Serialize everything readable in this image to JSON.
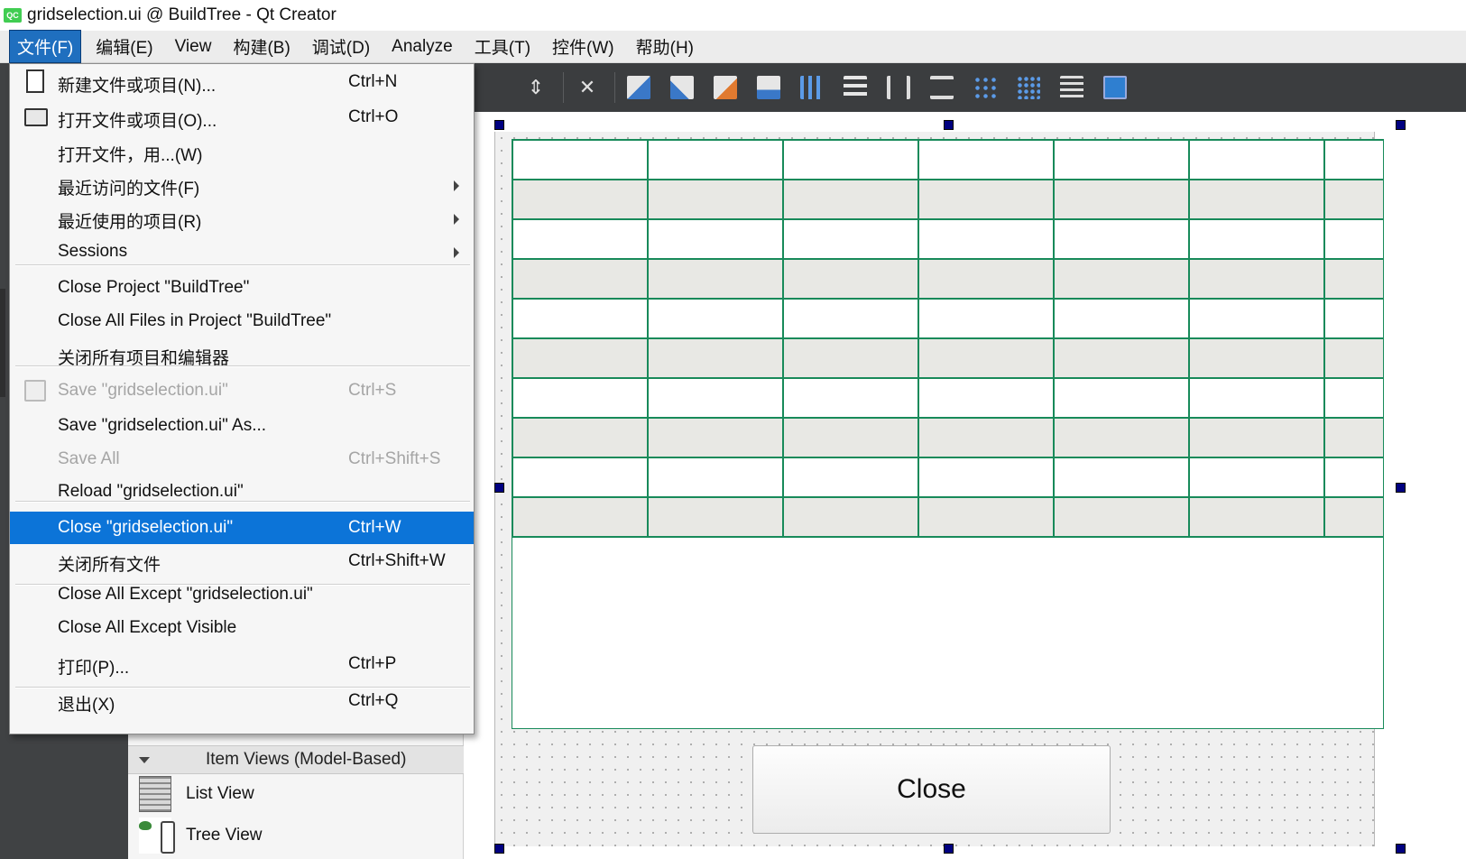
{
  "window": {
    "title": "gridselection.ui @ BuildTree - Qt Creator",
    "app_icon_text": "QC"
  },
  "menubar": {
    "items": [
      {
        "label": "文件(F)",
        "active": true
      },
      {
        "label": "编辑(E)"
      },
      {
        "label": "View"
      },
      {
        "label": "构建(B)"
      },
      {
        "label": "调试(D)"
      },
      {
        "label": "Analyze"
      },
      {
        "label": "工具(T)"
      },
      {
        "label": "控件(W)"
      },
      {
        "label": "帮助(H)"
      }
    ]
  },
  "file_menu": {
    "items": [
      {
        "label": "新建文件或项目(N)...",
        "shortcut": "Ctrl+N",
        "icon": "new-file-icon"
      },
      {
        "label": "打开文件或项目(O)...",
        "shortcut": "Ctrl+O",
        "icon": "open-folder-icon"
      },
      {
        "label": "打开文件，用...(W)",
        "shortcut": ""
      },
      {
        "label": "最近访问的文件(F)",
        "shortcut": "",
        "submenu": true
      },
      {
        "label": "最近使用的项目(R)",
        "shortcut": "",
        "submenu": true
      },
      {
        "label": "Sessions",
        "shortcut": "",
        "submenu": true
      },
      {
        "label": "Close Project \"BuildTree\"",
        "shortcut": ""
      },
      {
        "label": "Close All Files in Project \"BuildTree\"",
        "shortcut": ""
      },
      {
        "label": "关闭所有项目和编辑器",
        "shortcut": ""
      },
      {
        "label": "Save \"gridselection.ui\"",
        "shortcut": "Ctrl+S",
        "disabled": true,
        "icon": "save-icon"
      },
      {
        "label": "Save \"gridselection.ui\" As...",
        "shortcut": ""
      },
      {
        "label": "Save All",
        "shortcut": "Ctrl+Shift+S",
        "disabled": true
      },
      {
        "label": "Reload \"gridselection.ui\"",
        "shortcut": ""
      },
      {
        "label": "Close \"gridselection.ui\"",
        "shortcut": "Ctrl+W",
        "highlighted": true
      },
      {
        "label": "关闭所有文件",
        "shortcut": "Ctrl+Shift+W"
      },
      {
        "label": "Close All Except \"gridselection.ui\"",
        "shortcut": ""
      },
      {
        "label": "Close All Except Visible",
        "shortcut": ""
      },
      {
        "label": "打印(P)...",
        "shortcut": "Ctrl+P"
      },
      {
        "label": "退出(X)",
        "shortcut": "Ctrl+Q"
      }
    ]
  },
  "toolbar": {
    "icons": [
      "sort-arrows-icon",
      "break-layout-icon",
      "edit-widgets-icon",
      "edit-signals-icon",
      "edit-buddies-icon",
      "edit-tab-order-icon",
      "layout-horizontal-icon",
      "layout-vertical-icon",
      "splitter-horizontal-icon",
      "splitter-vertical-icon",
      "layout-form-icon",
      "layout-grid-icon",
      "break-icon",
      "adjust-size-icon"
    ]
  },
  "widget_box": {
    "category": "Item Views (Model-Based)",
    "items": [
      {
        "label": "List View",
        "icon": "list-view-icon"
      },
      {
        "label": "Tree View",
        "icon": "tree-view-icon"
      }
    ]
  },
  "form": {
    "table": {
      "rows": 10,
      "columns": 7,
      "grid_color": "#188a5a",
      "alt_row_color": "#e8e8e4"
    },
    "close_button_label": "Close"
  },
  "colors": {
    "highlight": "#0c74d8",
    "toolbar_bg": "#3b3d3f",
    "sidebar_bg": "#404244"
  }
}
